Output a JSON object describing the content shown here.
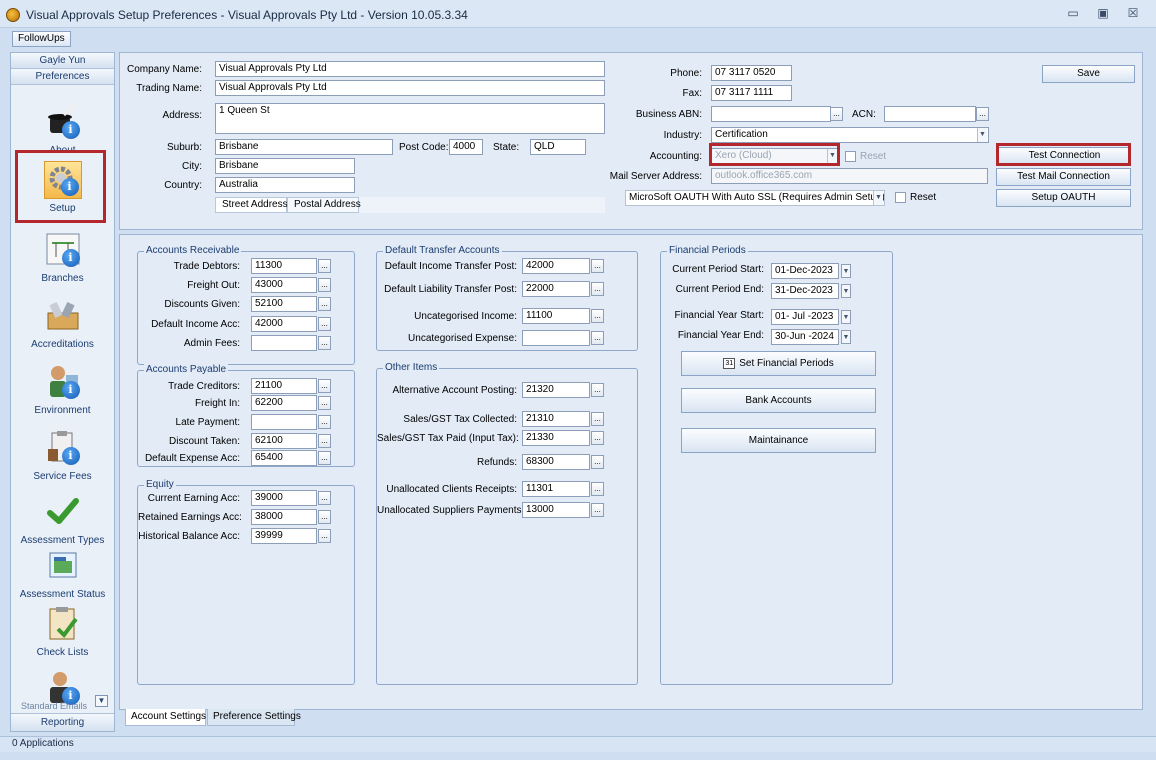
{
  "window": {
    "title": "Visual Approvals Setup Preferences - Visual Approvals Pty Ltd - Version 10.05.3.34",
    "minimize": "▭",
    "maximize": "▣",
    "close": "☒"
  },
  "menubar": {
    "followups": "FollowUps"
  },
  "sidebar": {
    "user": "Gayle Yun",
    "section": "Preferences",
    "footer": "Reporting",
    "cut_item": "Standard Emails",
    "items": [
      {
        "label": "About",
        "icon": "about-icon"
      },
      {
        "label": "Setup",
        "icon": "setup-gear-icon"
      },
      {
        "label": "Branches",
        "icon": "branches-icon"
      },
      {
        "label": "Accreditations",
        "icon": "accreditations-icon"
      },
      {
        "label": "Environment",
        "icon": "environment-icon"
      },
      {
        "label": "Service Fees",
        "icon": "service-fees-icon"
      },
      {
        "label": "Assessment Types",
        "icon": "checkmark-icon"
      },
      {
        "label": "Assessment Status",
        "icon": "status-icon"
      },
      {
        "label": "Check Lists",
        "icon": "checklist-icon"
      },
      {
        "label": "",
        "icon": "user-info-icon"
      }
    ]
  },
  "company": {
    "company_name_label": "Company Name:",
    "company_name": "Visual Approvals Pty Ltd",
    "trading_name_label": "Trading Name:",
    "trading_name": "Visual Approvals Pty Ltd",
    "address_label": "Address:",
    "address": "1 Queen St",
    "suburb_label": "Suburb:",
    "suburb": "Brisbane",
    "postcode_label": "Post Code:",
    "postcode": "4000",
    "state_label": "State:",
    "state": "QLD",
    "city_label": "City:",
    "city": "Brisbane",
    "country_label": "Country:",
    "country": "Australia",
    "address_tabs": [
      "Street Address",
      "Postal Address"
    ]
  },
  "contact": {
    "phone_label": "Phone:",
    "phone": "07 3117 0520",
    "fax_label": "Fax:",
    "fax": "07 3117 1111",
    "abn_label": "Business ABN:",
    "abn": "",
    "acn_label": "ACN:",
    "acn": "",
    "industry_label": "Industry:",
    "industry": "Certification",
    "accounting_label": "Accounting:",
    "accounting": "Xero (Cloud)",
    "reset_label": "Reset",
    "mail_server_label": "Mail Server Address:",
    "mail_server_placeholder": "outlook.office365.com",
    "auth_mode": "MicroSoft OAUTH With Auto SSL (Requires Admin Setup)",
    "reset2_label": "Reset"
  },
  "buttons": {
    "save": "Save",
    "test_connection": "Test Connection",
    "test_mail": "Test Mail Connection",
    "setup_oauth": "Setup OAUTH",
    "ellipsis": "...",
    "set_financial_periods": "Set Financial Periods",
    "calendar_glyph": "31",
    "bank_accounts": "Bank Accounts",
    "maintainance": "Maintainance"
  },
  "accounts_receivable": {
    "title": "Accounts Receivable",
    "rows": [
      {
        "label": "Trade Debtors:",
        "value": "11300"
      },
      {
        "label": "Freight Out:",
        "value": "43000"
      },
      {
        "label": "Discounts Given:",
        "value": "52100"
      },
      {
        "label": "Default Income Acc:",
        "value": "42000"
      },
      {
        "label": "Admin Fees:",
        "value": ""
      }
    ]
  },
  "accounts_payable": {
    "title": "Accounts Payable",
    "rows": [
      {
        "label": "Trade Creditors:",
        "value": "21100"
      },
      {
        "label": "Freight In:",
        "value": "62200"
      },
      {
        "label": "Late Payment:",
        "value": ""
      },
      {
        "label": "Discount Taken:",
        "value": "62100"
      },
      {
        "label": "Default Expense Acc:",
        "value": "65400"
      }
    ]
  },
  "equity": {
    "title": "Equity",
    "rows": [
      {
        "label": "Current Earning Acc:",
        "value": "39000"
      },
      {
        "label": "Retained Earnings Acc:",
        "value": "38000"
      },
      {
        "label": "Historical Balance Acc:",
        "value": "39999"
      }
    ]
  },
  "default_transfer": {
    "title": "Default Transfer Accounts",
    "rows": [
      {
        "label": "Default Income Transfer Post:",
        "value": "42000"
      },
      {
        "label": "Default Liability Transfer Post:",
        "value": "22000"
      },
      {
        "label": "Uncategorised Income:",
        "value": "11100"
      },
      {
        "label": "Uncategorised Expense:",
        "value": ""
      }
    ]
  },
  "other_items": {
    "title": "Other Items",
    "rows": [
      {
        "label": "Alternative Account Posting:",
        "value": "21320"
      },
      {
        "label": "Sales/GST Tax Collected:",
        "value": "21310"
      },
      {
        "label": "Sales/GST Tax Paid (Input Tax):",
        "value": "21330"
      },
      {
        "label": "Refunds:",
        "value": "68300"
      },
      {
        "label": "Unallocated Clients Receipts:",
        "value": "11301"
      },
      {
        "label": "Unallocated Suppliers Payments:",
        "value": "13000"
      }
    ]
  },
  "financial_periods": {
    "title": "Financial Periods",
    "rows": [
      {
        "label": "Current Period Start:",
        "value": "01-Dec-2023"
      },
      {
        "label": "Current Period End:",
        "value": "31-Dec-2023"
      },
      {
        "label": "Financial Year Start:",
        "value": "01- Jul -2023"
      },
      {
        "label": "Financial Year End:",
        "value": "30-Jun -2024"
      }
    ]
  },
  "bottom_tabs": {
    "account_settings": "Account Settings",
    "preference_settings": "Preference Settings"
  },
  "status": {
    "text": "0 Applications"
  }
}
